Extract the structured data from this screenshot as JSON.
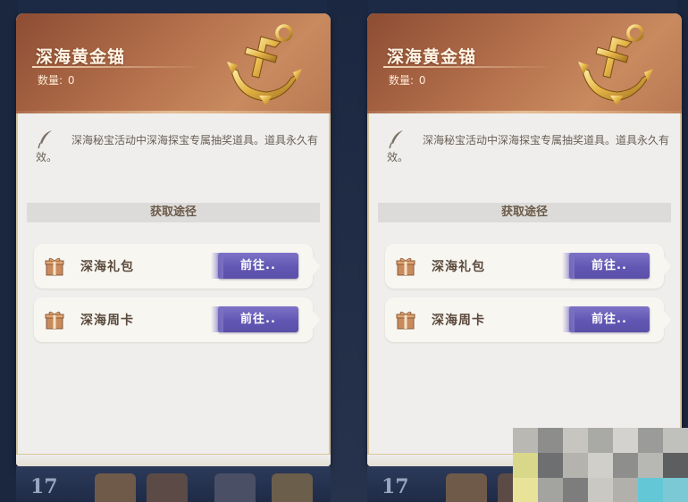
{
  "panels": [
    {
      "item_name": "深海黄金锚",
      "quantity_label": "数量:",
      "quantity_value": "0",
      "description": "深海秘宝活动中深海探宝专属抽奖道具。道具永久有效。",
      "section_title": "获取途径",
      "routes": [
        {
          "label": "深海礼包",
          "button": "前往.."
        },
        {
          "label": "深海周卡",
          "button": "前往.."
        }
      ],
      "bottom_number": "17"
    },
    {
      "item_name": "深海黄金锚",
      "quantity_label": "数量:",
      "quantity_value": "0",
      "description": "深海秘宝活动中深海探宝专属抽奖道具。道具永久有效。",
      "section_title": "获取途径",
      "routes": [
        {
          "label": "深海礼包",
          "button": "前往.."
        },
        {
          "label": "深海周卡",
          "button": "前往.."
        }
      ],
      "bottom_number": "17"
    }
  ],
  "icons": {
    "item": "gold-anchor-icon",
    "description": "quill-icon",
    "route": "gift-box-icon"
  },
  "colors": {
    "header": "#b4704c",
    "button": "#6257b3",
    "panel_bg": "#efeeec",
    "section_bar": "#dcdbd9"
  }
}
